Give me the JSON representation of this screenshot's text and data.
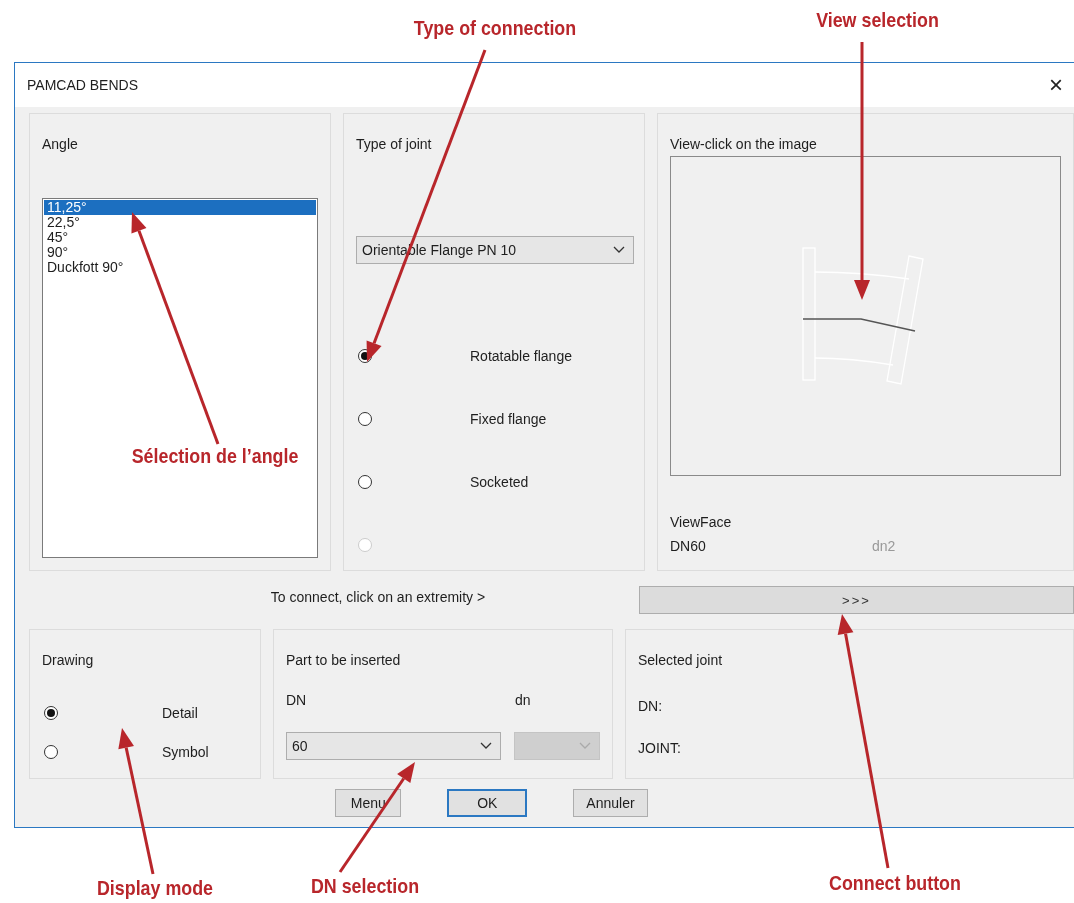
{
  "window": {
    "title": "PAMCAD BENDS",
    "close": "×"
  },
  "angle_panel": {
    "title": "Angle",
    "items": [
      {
        "label": "11,25°",
        "selected": true
      },
      {
        "label": "22,5°",
        "selected": false
      },
      {
        "label": "45°",
        "selected": false
      },
      {
        "label": "90°",
        "selected": false
      },
      {
        "label": "Duckfott 90°",
        "selected": false
      }
    ]
  },
  "joint_panel": {
    "title": "Type of joint",
    "dropdown": {
      "value": "Orientable Flange PN 10"
    },
    "options": [
      {
        "label": "Rotatable flange",
        "selected": true,
        "disabled": false
      },
      {
        "label": "Fixed flange",
        "selected": false,
        "disabled": false
      },
      {
        "label": "Socketed",
        "selected": false,
        "disabled": false
      },
      {
        "selected": false,
        "disabled": true
      }
    ]
  },
  "view_panel": {
    "title": "View-click on the image",
    "face_label": "ViewFace",
    "dn": "DN60",
    "dn2": "dn2"
  },
  "connect_hint": "To connect, click on an extremity >",
  "connect_button": ">>>",
  "drawing_panel": {
    "title": "Drawing",
    "options": [
      {
        "label": "Detail",
        "selected": true
      },
      {
        "label": "Symbol",
        "selected": false
      }
    ]
  },
  "part_panel": {
    "title": "Part to be inserted",
    "dn_label": "DN",
    "dn_small_label": "dn",
    "dn_combo": {
      "value": "60",
      "disabled": false
    },
    "dn_small_combo": {
      "disabled": true
    }
  },
  "selected_joint_panel": {
    "title": "Selected joint",
    "fields": [
      "DN:",
      "JOINT:"
    ]
  },
  "buttons": [
    {
      "label": "Menu",
      "default": false
    },
    {
      "label": "OK",
      "default": true
    },
    {
      "label": "Annuler",
      "default": false
    }
  ],
  "annotations": [
    {
      "text": "Type of connection"
    },
    {
      "text": "View selection"
    },
    {
      "text": "Sélection de l’angle"
    },
    {
      "text": "Display mode"
    },
    {
      "text": "DN selection"
    },
    {
      "text": "Connect button"
    }
  ]
}
